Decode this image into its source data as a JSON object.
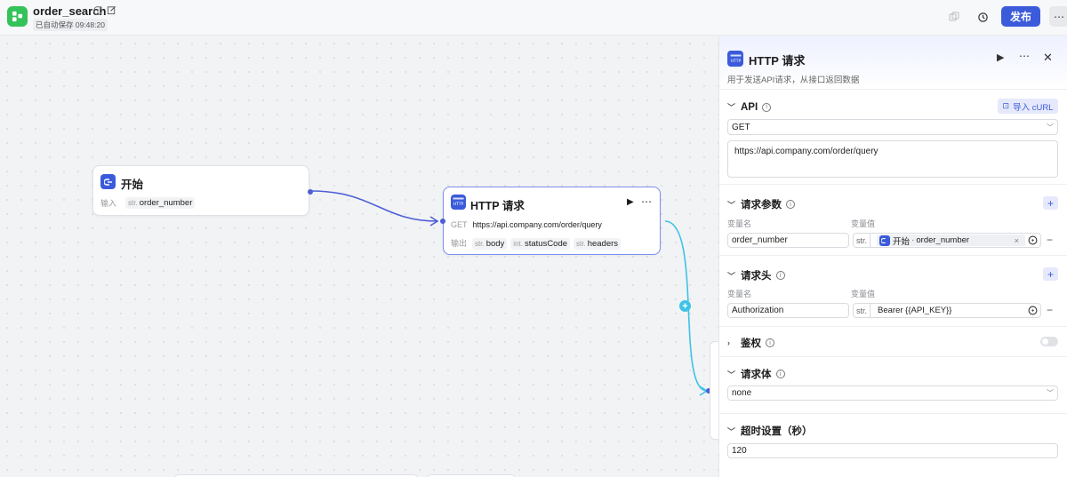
{
  "app": {
    "title": "order_search",
    "autosave": "已自动保存 09:48:20",
    "publish_label": "发布",
    "more_label": "⋯"
  },
  "canvas": {
    "start_node": {
      "title": "开始",
      "input_label": "输入",
      "input_type": "str.",
      "input_name": "order_number"
    },
    "http_node": {
      "title": "HTTP 请求",
      "method": "GET",
      "url": "https://api.company.com/order/query",
      "output_label": "输出",
      "outputs": [
        {
          "type": "str.",
          "name": "body"
        },
        {
          "type": "int.",
          "name": "statusCode"
        },
        {
          "type": "str.",
          "name": "headers"
        }
      ]
    },
    "add_node_label": "+"
  },
  "panel": {
    "title": "HTTP 请求",
    "description": "用于发送API请求，从接口返回数据",
    "api": {
      "label": "API",
      "import_label": "导入 cURL",
      "method": "GET",
      "url": "https://api.company.com/order/query"
    },
    "params": {
      "label": "请求参数",
      "col_name": "变量名",
      "col_value": "变量值",
      "row": {
        "name": "order_number",
        "type": "str.",
        "source_node": "开始",
        "source_sep": "·",
        "source_var": "order_number"
      }
    },
    "headers": {
      "label": "请求头",
      "col_name": "变量名",
      "col_value": "变量值",
      "row": {
        "name": "Authorization",
        "type": "str.",
        "value": "Bearer {{API_KEY}}"
      }
    },
    "auth": {
      "label": "鉴权",
      "enabled": false
    },
    "body": {
      "label": "请求体",
      "value": "none"
    },
    "timeout": {
      "label": "超时设置（秒）",
      "value": "120"
    }
  }
}
